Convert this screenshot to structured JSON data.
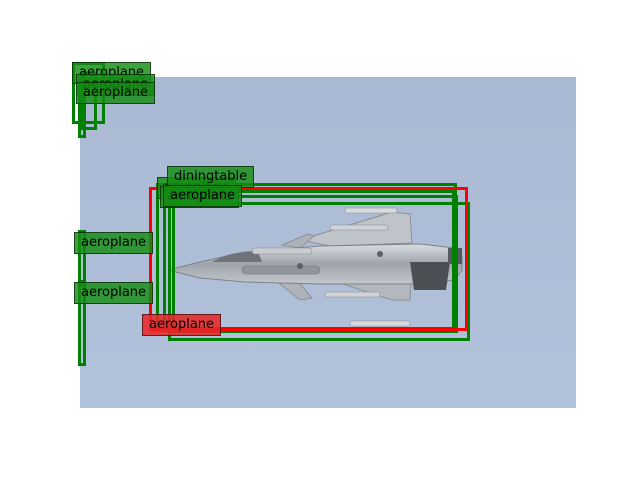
{
  "image": {
    "subject": "fighter-jet",
    "sky_color": "#aebdd6"
  },
  "colors": {
    "ground_truth": "#ff0000",
    "prediction": "#008000",
    "gt_label_bg": "rgba(230,40,40,0.88)",
    "pred_label_bg": "rgba(20,140,20,0.82)"
  },
  "detections": [
    {
      "id": "pred-1",
      "kind": "prediction",
      "label": "aeroplane"
    },
    {
      "id": "pred-2",
      "kind": "prediction",
      "label": "aeroplane"
    },
    {
      "id": "pred-3",
      "kind": "prediction",
      "label": "aeroplane"
    },
    {
      "id": "pred-4",
      "kind": "prediction",
      "label": "aeroplane"
    },
    {
      "id": "pred-5",
      "kind": "prediction",
      "label": "aeroplane"
    },
    {
      "id": "pred-6",
      "kind": "prediction",
      "label": "aeroplane"
    },
    {
      "id": "pred-7",
      "kind": "prediction",
      "label": "aeroplane"
    },
    {
      "id": "pred-8",
      "kind": "prediction",
      "label": "diningtable"
    },
    {
      "id": "pred-9",
      "kind": "prediction",
      "label": "aeroplane"
    },
    {
      "id": "gt-1",
      "kind": "ground_truth",
      "label": "aeroplane"
    }
  ]
}
